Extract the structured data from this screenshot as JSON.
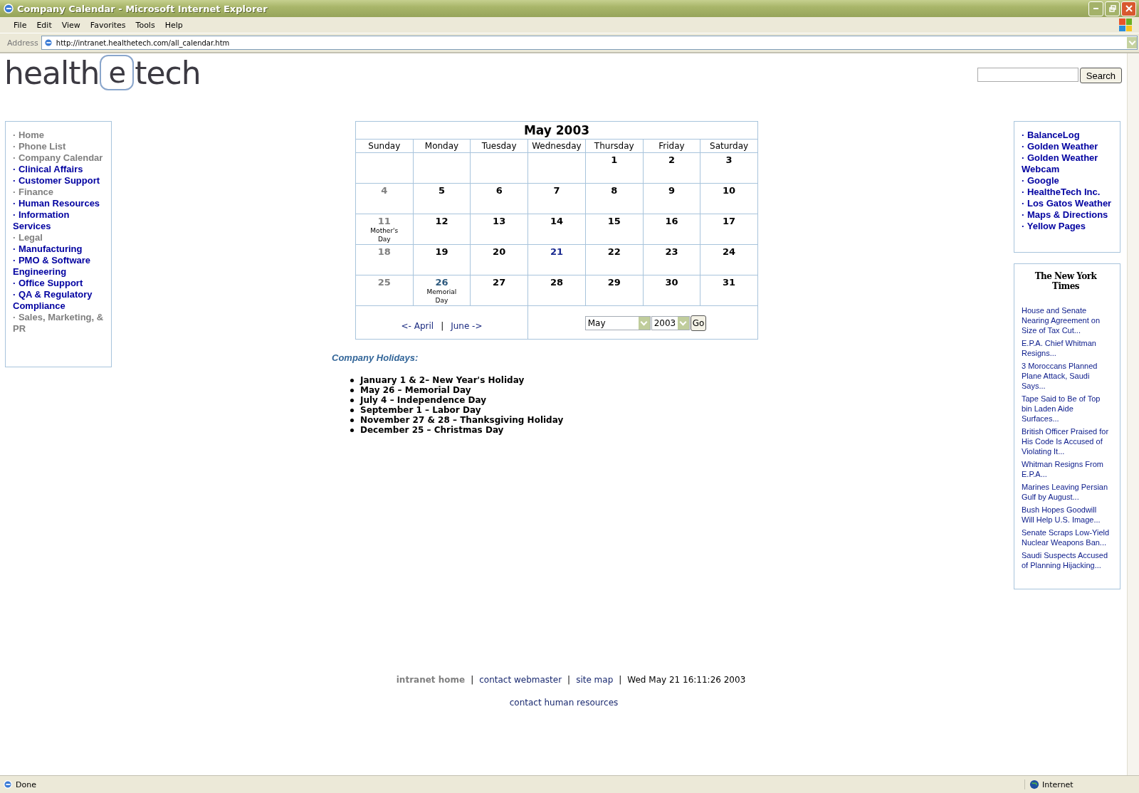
{
  "window": {
    "title": "Company Calendar - Microsoft Internet Explorer"
  },
  "menu": [
    "File",
    "Edit",
    "View",
    "Favorites",
    "Tools",
    "Help"
  ],
  "address_bar": {
    "label": "Address",
    "url": "http://intranet.healthetech.com/all_calendar.htm"
  },
  "logo": {
    "before": "health",
    "mark": "e",
    "after": "tech"
  },
  "search": {
    "button": "Search"
  },
  "nav_links": [
    {
      "label": "· Home",
      "disabled": true
    },
    {
      "label": "· Phone List",
      "disabled": true
    },
    {
      "label": "· Company Calendar",
      "disabled": true
    },
    {
      "label": "· Clinical Affairs",
      "disabled": false
    },
    {
      "label": "· Customer Support",
      "disabled": false
    },
    {
      "label": "· Finance",
      "disabled": true
    },
    {
      "label": "· Human Resources",
      "disabled": false
    },
    {
      "label": "· Information Services",
      "disabled": false
    },
    {
      "label": "· Legal",
      "disabled": true
    },
    {
      "label": "· Manufacturing",
      "disabled": false
    },
    {
      "label": "· PMO & Software Engineering",
      "disabled": false
    },
    {
      "label": "· Office Support",
      "disabled": false
    },
    {
      "label": "· QA & Regulatory Compliance",
      "disabled": false
    },
    {
      "label": "· Sales, Marketing, & PR",
      "disabled": true
    }
  ],
  "calendar": {
    "title": "May 2003",
    "weekdays": [
      "Sunday",
      "Monday",
      "Tuesday",
      "Wednesday",
      "Thursday",
      "Friday",
      "Saturday"
    ],
    "weeks": [
      [
        {
          "kind": "empty"
        },
        {
          "kind": "empty"
        },
        {
          "kind": "empty"
        },
        {
          "kind": "empty"
        },
        {
          "day": "1",
          "kind": "weekday"
        },
        {
          "day": "2",
          "kind": "weekday"
        },
        {
          "day": "3",
          "kind": "weekday"
        }
      ],
      [
        {
          "day": "4",
          "kind": "sunday"
        },
        {
          "day": "5",
          "kind": "weekday"
        },
        {
          "day": "6",
          "kind": "weekday"
        },
        {
          "day": "7",
          "kind": "weekday"
        },
        {
          "day": "8",
          "kind": "weekday"
        },
        {
          "day": "9",
          "kind": "weekday"
        },
        {
          "day": "10",
          "kind": "weekday"
        }
      ],
      [
        {
          "day": "11",
          "kind": "sunday",
          "note": "Mother's Day"
        },
        {
          "day": "12",
          "kind": "weekday"
        },
        {
          "day": "13",
          "kind": "weekday"
        },
        {
          "day": "14",
          "kind": "weekday"
        },
        {
          "day": "15",
          "kind": "weekday"
        },
        {
          "day": "16",
          "kind": "weekday"
        },
        {
          "day": "17",
          "kind": "weekday"
        }
      ],
      [
        {
          "day": "18",
          "kind": "sunday"
        },
        {
          "day": "19",
          "kind": "weekday"
        },
        {
          "day": "20",
          "kind": "weekday"
        },
        {
          "day": "21",
          "kind": "today"
        },
        {
          "day": "22",
          "kind": "weekday"
        },
        {
          "day": "23",
          "kind": "weekday"
        },
        {
          "day": "24",
          "kind": "weekday"
        }
      ],
      [
        {
          "day": "25",
          "kind": "sunday"
        },
        {
          "day": "26",
          "kind": "holiday",
          "note": "Memorial Day"
        },
        {
          "day": "27",
          "kind": "weekday"
        },
        {
          "day": "28",
          "kind": "weekday"
        },
        {
          "day": "29",
          "kind": "weekday"
        },
        {
          "day": "30",
          "kind": "weekday"
        },
        {
          "day": "31",
          "kind": "weekday"
        }
      ]
    ],
    "prev": "<- April",
    "separator": "|",
    "next": "June ->",
    "month_select": "May",
    "year_select": "2003",
    "go": "Go"
  },
  "holidays": {
    "heading": "Company Holidays:",
    "items": [
      "January 1 & 2– New Year's Holiday",
      "May 26 – Memorial Day",
      "July 4 – Independence Day",
      "September 1 – Labor Day",
      "November 27 & 28 – Thanksgiving Holiday",
      "December 25 – Christmas Day"
    ]
  },
  "quick_links": [
    "· BalanceLog",
    "· Golden Weather",
    "· Golden Weather Webcam",
    "· Google",
    "· HealtheTech Inc.",
    "· Los Gatos Weather",
    "· Maps & Directions",
    "· Yellow Pages"
  ],
  "news": {
    "source": "The New York Times",
    "headlines": [
      "House and Senate Nearing Agreement on Size of Tax Cut...",
      "E.P.A. Chief Whitman Resigns...",
      "3 Moroccans Planned Plane Attack, Saudi Says...",
      "Tape Said to Be of Top bin Laden Aide Surfaces...",
      "British Officer Praised for His Code Is Accused of Violating It...",
      "Whitman Resigns From E.P.A...",
      "Marines Leaving Persian Gulf by August...",
      "Bush Hopes Goodwill Will Help U.S. Image...",
      "Senate Scraps Low-Yield Nuclear Weapons Ban...",
      "Saudi Suspects Accused of Planning Hijacking..."
    ]
  },
  "footer": {
    "items": [
      {
        "kind": "current",
        "text": "intranet home"
      },
      {
        "kind": "separator",
        "text": "|"
      },
      {
        "kind": "link",
        "text": "contact webmaster"
      },
      {
        "kind": "separator",
        "text": "|"
      },
      {
        "kind": "link",
        "text": "site map"
      },
      {
        "kind": "separator",
        "text": "|"
      },
      {
        "kind": "date",
        "text": "Wed May 21 16:11:26 2003"
      }
    ],
    "second_link": "contact human resources"
  },
  "status_bar": {
    "text": "Done",
    "zone": "Internet"
  }
}
